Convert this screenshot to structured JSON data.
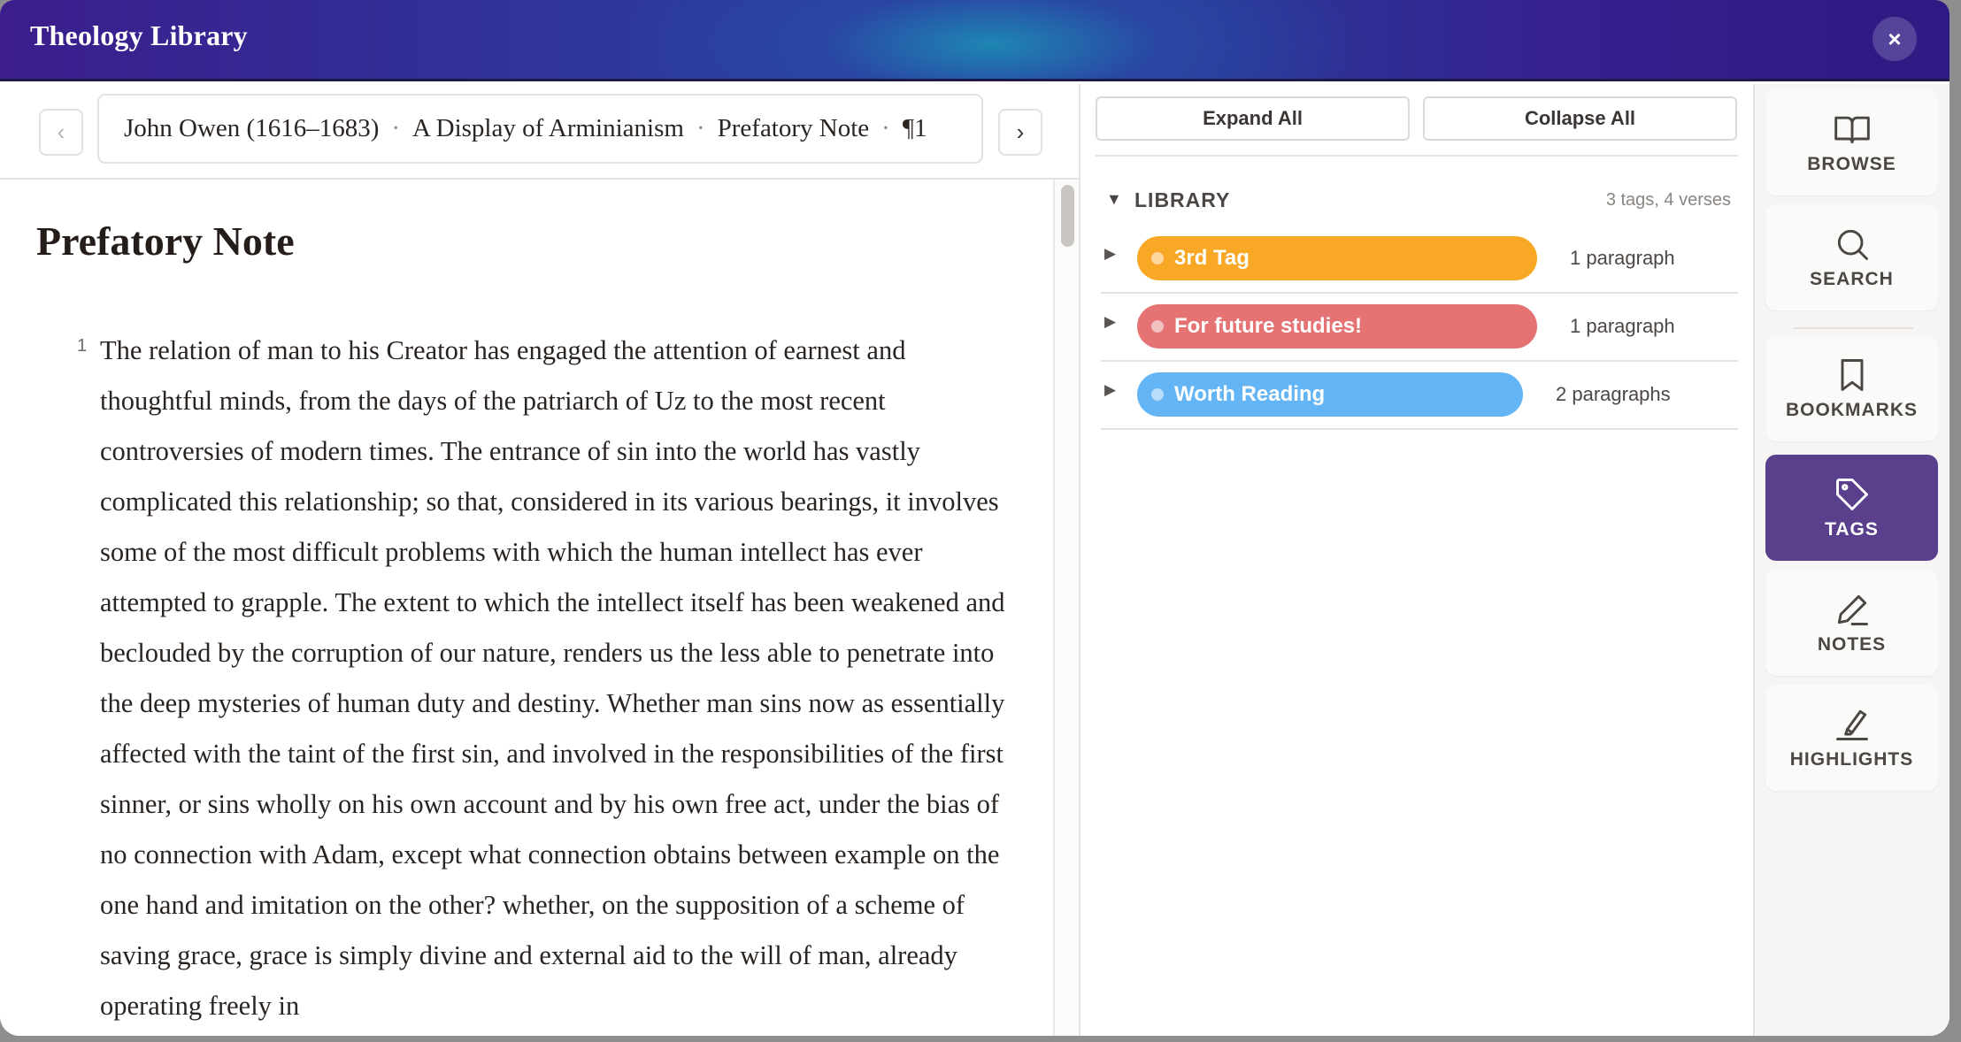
{
  "app": {
    "title": "Theology Library",
    "close_label": "×"
  },
  "nav": {
    "prev_label": "‹",
    "next_label": "›",
    "breadcrumb": {
      "author": "John Owen (1616–1683)",
      "work": "A Display of Arminianism",
      "section": "Prefatory Note",
      "paragraph": "¶1",
      "separator": "·"
    }
  },
  "reader": {
    "chapter_title": "Prefatory Note",
    "verse_number": "1",
    "verse_text": "The relation of man to his Creator has engaged the attention of earnest and thoughtful minds, from the days of the patriarch of Uz to the most recent controversies of modern times. The entrance of sin into the world has vastly complicated this relationship; so that, considered in its various bearings, it involves some of the most difficult problems with which the human intellect has ever attempted to grapple. The extent to which the intellect itself has been weakened and beclouded by the corruption of our nature, renders us the less able to penetrate into the deep mysteries of human duty and destiny. Whether man sins now as essentially affected with the taint of the first sin, and involved in the responsibilities of the first sinner, or sins wholly on his own account and by his own free act, under the bias of no connection with Adam, except what connection obtains between example on the one hand and imitation on the other? whether, on the supposition of a scheme of saving grace, grace is simply divine and external aid to the will of man, already operating freely in"
  },
  "tags_panel": {
    "expand_all_label": "Expand All",
    "collapse_all_label": "Collapse All",
    "library": {
      "caret": "▼",
      "title": "LIBRARY",
      "count": "3 tags, 4 verses",
      "tags": [
        {
          "caret": "▶",
          "name": "3rd Tag",
          "color": "#f9a825",
          "count": "1 paragraph"
        },
        {
          "caret": "▶",
          "name": "For future studies!",
          "color": "#e57373",
          "count": "1 paragraph"
        },
        {
          "caret": "▶",
          "name": "Worth Reading",
          "color": "#64b5f6",
          "count": "2 paragraphs"
        }
      ]
    }
  },
  "sidebar": {
    "items": [
      {
        "label": "BROWSE",
        "icon": "book-open-icon",
        "active": false
      },
      {
        "label": "SEARCH",
        "icon": "search-icon",
        "active": false
      },
      {
        "label": "BOOKMARKS",
        "icon": "bookmark-icon",
        "active": false
      },
      {
        "label": "TAGS",
        "icon": "tag-icon",
        "active": true
      },
      {
        "label": "NOTES",
        "icon": "pencil-icon",
        "active": false
      },
      {
        "label": "HIGHLIGHTS",
        "icon": "highlighter-icon",
        "active": false
      }
    ],
    "active_color": "#5a3f8c"
  }
}
